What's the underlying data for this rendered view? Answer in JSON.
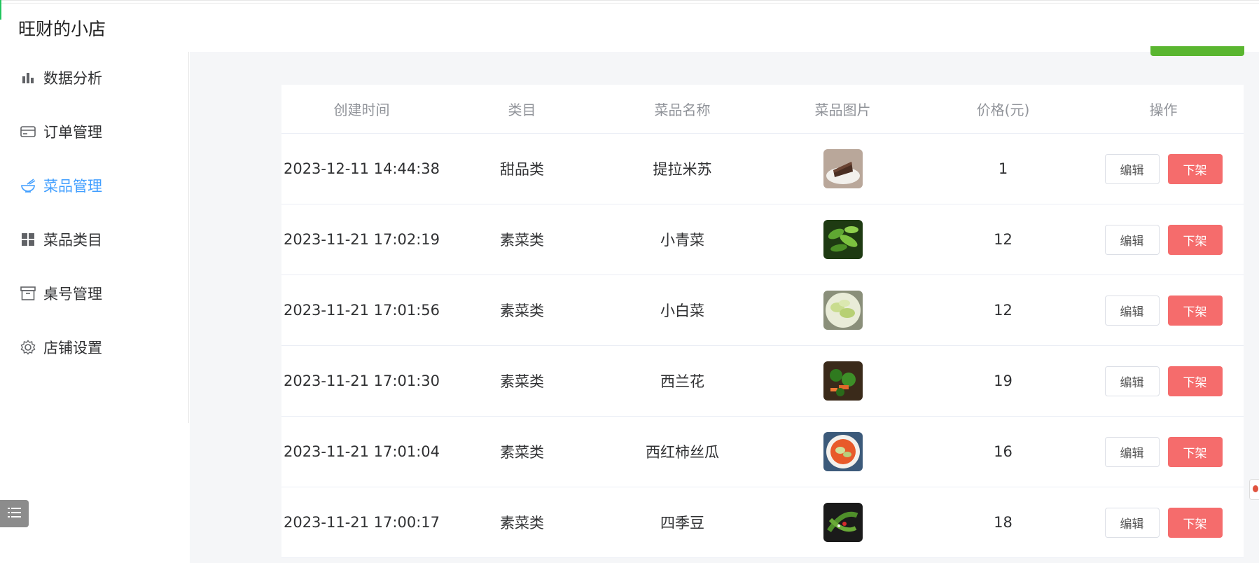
{
  "shop_name": "旺财的小店",
  "sidebar": {
    "items": [
      {
        "label": "数据分析",
        "icon": "bar-chart-icon",
        "active": false
      },
      {
        "label": "订单管理",
        "icon": "card-icon",
        "active": false
      },
      {
        "label": "菜品管理",
        "icon": "bowl-icon",
        "active": true
      },
      {
        "label": "菜品类目",
        "icon": "grid-icon",
        "active": false
      },
      {
        "label": "桌号管理",
        "icon": "box-icon",
        "active": false
      },
      {
        "label": "店铺设置",
        "icon": "gear-icon",
        "active": false
      }
    ]
  },
  "colors": {
    "accent": "#409eff",
    "danger": "#f56c6c",
    "success": "#5ab630"
  },
  "table": {
    "headers": [
      "创建时间",
      "类目",
      "菜品名称",
      "菜品图片",
      "价格(元)",
      "操作"
    ],
    "rows": [
      {
        "created": "2023-12-11 14:44:38",
        "category": "甜品类",
        "name": "提拉米苏",
        "image": "tiramisu",
        "price": "1"
      },
      {
        "created": "2023-11-21 17:02:19",
        "category": "素菜类",
        "name": "小青菜",
        "image": "greens",
        "price": "12"
      },
      {
        "created": "2023-11-21 17:01:56",
        "category": "素菜类",
        "name": "小白菜",
        "image": "cabbage",
        "price": "12"
      },
      {
        "created": "2023-11-21 17:01:30",
        "category": "素菜类",
        "name": "西兰花",
        "image": "broccoli",
        "price": "19"
      },
      {
        "created": "2023-11-21 17:01:04",
        "category": "素菜类",
        "name": "西红柿丝瓜",
        "image": "tomato-gourd",
        "price": "16"
      },
      {
        "created": "2023-11-21 17:00:17",
        "category": "素菜类",
        "name": "四季豆",
        "image": "green-beans",
        "price": "18"
      }
    ],
    "edit_label": "编辑",
    "offshelf_label": "下架"
  }
}
